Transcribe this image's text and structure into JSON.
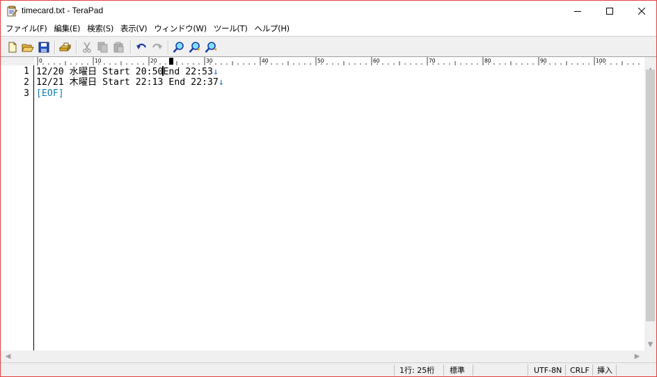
{
  "window": {
    "title": "timecard.txt - TeraPad",
    "icon": "terapad-app-icon",
    "controls": [
      "minimize-icon",
      "maximize-icon",
      "close-icon"
    ]
  },
  "menu": [
    {
      "label": "ファイル(F)"
    },
    {
      "label": "編集(E)"
    },
    {
      "label": "検索(S)"
    },
    {
      "label": "表示(V)"
    },
    {
      "label": "ウィンドウ(W)"
    },
    {
      "label": "ツール(T)"
    },
    {
      "label": "ヘルプ(H)"
    }
  ],
  "toolbar": {
    "icons": [
      "new-file-icon",
      "open-folder-icon",
      "save-icon",
      "print-icon",
      "cut-icon",
      "copy-icon",
      "paste-icon",
      "undo-icon",
      "redo-icon",
      "find-icon",
      "find-next-icon",
      "find-prev-icon"
    ]
  },
  "ruler": {
    "labels": [
      "0",
      "10",
      "20",
      "30",
      "40",
      "50",
      "60",
      "70",
      "80",
      "90",
      "100"
    ]
  },
  "editor": {
    "lines": [
      {
        "number": "1",
        "before_caret": "12/20 水曜日 Start 20:50",
        "after_caret": "End 22:53",
        "eol": "↓"
      },
      {
        "number": "2",
        "text": "12/21 木曜日 Start 22:13 End 22:37",
        "eol": "↓"
      },
      {
        "number": "3",
        "text": "[EOF]"
      }
    ]
  },
  "scrollbar": {
    "up": "▲",
    "down": "▼",
    "left": "◀",
    "right": "▶"
  },
  "status": {
    "position": "1行:  25桁",
    "mode": "標準",
    "encoding": "UTF-8N",
    "line_ending": "CRLF",
    "insert_mode": "挿入"
  },
  "colors": {
    "eol_marker": "#1a6fd0",
    "eof_marker": "#0f7fb5",
    "window_border": "#e04040"
  }
}
